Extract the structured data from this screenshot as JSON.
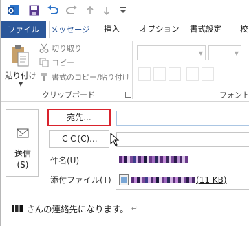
{
  "quick_access": {
    "icons": [
      "app-logo-icon",
      "save-icon",
      "undo-icon",
      "redo-icon",
      "up-icon",
      "down-icon",
      "customize-icon"
    ]
  },
  "tabs": [
    {
      "label": "ファイル",
      "active": false
    },
    {
      "label": "メッセージ",
      "active": true
    },
    {
      "label": "挿入",
      "active": false
    },
    {
      "label": "オプション",
      "active": false
    },
    {
      "label": "書式設定",
      "active": false
    },
    {
      "label": "校",
      "active": false
    }
  ],
  "ribbon": {
    "clipboard": {
      "paste_label": "貼り付け",
      "cut_label": "切り取り",
      "copy_label": "コピー",
      "format_painter_label": "書式のコピー/貼り付け",
      "group_label": "クリップボード"
    },
    "font": {
      "group_label": "フォント"
    }
  },
  "compose": {
    "send_label": "送信",
    "send_shortcut": "(S)",
    "to_button": "宛先...",
    "cc_button": "ＣＣ(C)...",
    "subject_label": "件名(U)",
    "attachment_label": "添付ファイル(T)",
    "attachment_size": "(11 KB)",
    "body_text": "さんの連絡先になります。",
    "paragraph_mark": "↵"
  },
  "colors": {
    "accent": "#2b579a",
    "highlight_border": "#d9232d",
    "redacted": "#5a2d7a"
  }
}
